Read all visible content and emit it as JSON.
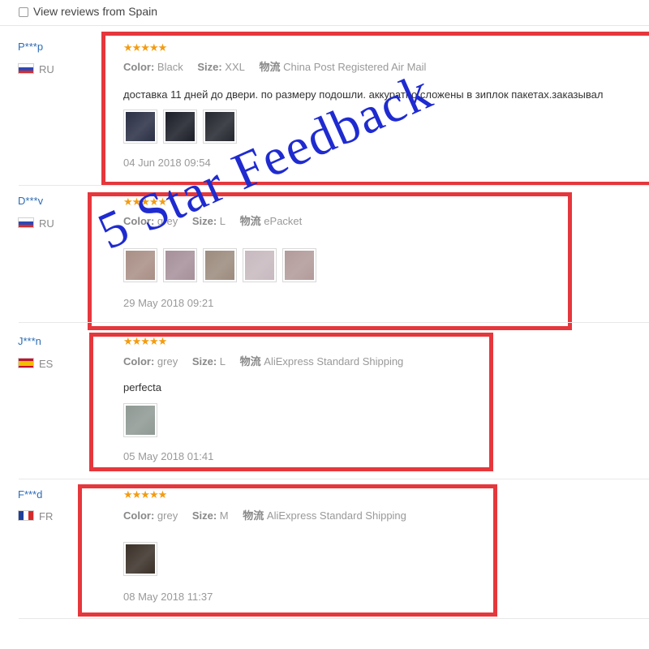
{
  "filter": {
    "label": "View reviews from Spain",
    "checked": false
  },
  "watermark": "5 Star Feedback",
  "reviews": [
    {
      "user": "P***p",
      "country": "RU",
      "stars": "★★★★★",
      "color_label": "Color:",
      "color": "Black",
      "size_label": "Size:",
      "size": "XXL",
      "ship_label": "物流",
      "shipping": "China Post Registered Air Mail",
      "text": "доставка 11 дней до двери. по размеру подошли. аккуратно сложены в зиплок пакетах.заказывал",
      "date": "04 Jun 2018 09:54",
      "thumbs": [
        "#2b2f45",
        "#1b1e27",
        "#24272e"
      ]
    },
    {
      "user": "D***v",
      "country": "RU",
      "stars": "★★★★★",
      "color_label": "Color:",
      "color": "grey",
      "size_label": "Size:",
      "size": "L",
      "ship_label": "物流",
      "shipping": "ePacket",
      "text": "",
      "date": "29 May 2018 09:21",
      "thumbs": [
        "#a98f86",
        "#a6909a",
        "#9c8b7e",
        "#c7b9bf",
        "#b29a9a"
      ]
    },
    {
      "user": "J***n",
      "country": "ES",
      "stars": "★★★★★",
      "color_label": "Color:",
      "color": "grey",
      "size_label": "Size:",
      "size": "L",
      "ship_label": "物流",
      "shipping": "AliExpress Standard Shipping",
      "text": "perfecta",
      "date": "05 May 2018 01:41",
      "thumbs": [
        "#8f9994"
      ]
    },
    {
      "user": "F***d",
      "country": "FR",
      "stars": "★★★★★",
      "color_label": "Color:",
      "color": "grey",
      "size_label": "Size:",
      "size": "M",
      "ship_label": "物流",
      "shipping": "AliExpress Standard Shipping",
      "text": "",
      "date": "08 May 2018 11:37",
      "thumbs": [
        "#3a3028"
      ]
    }
  ]
}
